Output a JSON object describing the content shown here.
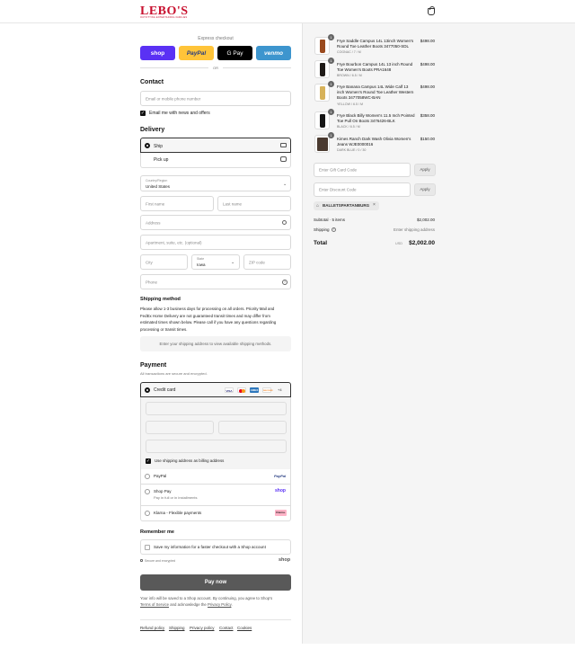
{
  "header": {
    "logo_text": "LEBO'S",
    "logo_tagline": "OUTFITTING ENTERTAINING FAMILIES",
    "cart_icon": "shopping-bag-icon"
  },
  "express": {
    "title": "Express checkout",
    "buttons": [
      {
        "label": "shop",
        "color": "#5a31f4"
      },
      {
        "label": "PayPal",
        "color": "#ffc439"
      },
      {
        "label": "G Pay",
        "color": "#000000"
      },
      {
        "label": "venmo",
        "color": "#3d95ce"
      }
    ],
    "or_label": "OR"
  },
  "contact": {
    "title": "Contact",
    "email_placeholder": "Email or mobile phone number",
    "news_label": "Email me with news and offers"
  },
  "delivery": {
    "title": "Delivery",
    "options": [
      {
        "label": "Ship",
        "icon": "truck-icon",
        "selected": true
      },
      {
        "label": "Pick up",
        "icon": "store-icon",
        "selected": false
      }
    ],
    "country_label": "Country/Region",
    "country_value": "United States",
    "first_name_ph": "First name",
    "last_name_ph": "Last name",
    "address_ph": "Address",
    "apartment_ph": "Apartment, suite, etc. (optional)",
    "city_ph": "City",
    "state_label": "State",
    "state_value": "Iowa",
    "zip_ph": "ZIP code",
    "phone_ph": "Phone"
  },
  "shipping_method": {
    "title": "Shipping method",
    "note": "Please allow 1-3 business days for processing on all orders. Priority Mail and FedEx Home Delivery are not guaranteed transit times and may differ from estimated times shown below. Please call if you have any questions regarding processing or transit times.",
    "placeholder_box": "Enter your shipping address to view available shipping methods."
  },
  "payment": {
    "title": "Payment",
    "subtitle": "All transactions are secure and encrypted.",
    "credit_card_label": "Credit card",
    "card_brands": [
      {
        "label": "VISA",
        "color": "#ffffff",
        "text": "#1a1f71"
      },
      {
        "label": "MC",
        "color": "#ffffff",
        "text": "#eb001b"
      },
      {
        "label": "AMEX",
        "color": "#2e77bc",
        "text": "#ffffff"
      },
      {
        "label": "DISCOVER",
        "color": "#ffffff",
        "text": "#f58220"
      }
    ],
    "more_cards": "+4",
    "billing_label": "Use shipping address as billing address",
    "methods": [
      {
        "label": "PayPal",
        "sub": "",
        "badge": "PayPal"
      },
      {
        "label": "Shop Pay",
        "sub": "Pay in full or in installments",
        "badge": "shop"
      },
      {
        "label": "Klarna - Flexible payments",
        "sub": "",
        "badge": "Klarna."
      }
    ]
  },
  "remember": {
    "title": "Remember me",
    "save_label": "Save my information for a faster checkout with a Shop account",
    "secure_label": "Secure and encrypted",
    "shop_logo": "shop"
  },
  "pay_now": "Pay now",
  "legal": {
    "line1": "Your info will be saved to a Shop account. By continuing, you agree to Shop's",
    "terms": "Terms of Service",
    "and_ack": "and acknowledge the",
    "privacy": "Privacy Policy",
    "period": "."
  },
  "footer_links": [
    "Refund policy",
    "Shipping",
    "Privacy policy",
    "Contact",
    "Cookies"
  ],
  "cart": {
    "items": [
      {
        "qty": "1",
        "name": "Frye Saddle Campus 14L 13inch Women's Round Toe Leather Boots 3477050-SDL",
        "variant": "COGNAC / 7 / M",
        "price": "$498.00",
        "color": "#9a4a1e"
      },
      {
        "qty": "1",
        "name": "Frye Bourbon Campus 14L 13 inch Round Toe Women's Boots PRA1648",
        "variant": "BROWN / 6.5 / M",
        "price": "$498.00",
        "color": "#1e1a17"
      },
      {
        "qty": "1",
        "name": "Frye Banana Campus 14L Wide Calf 13 inch Women's Round Toe Leather Western Boots 3477058WC-BAN",
        "variant": "YELLOW / 6.5 / M",
        "price": "$498.00",
        "color": "#d7b25a"
      },
      {
        "qty": "1",
        "name": "Frye Black Billy Women's 11.5 Inch Pointed Toe Pull On Boots 3476426-BLK",
        "variant": "BLACK / 6.5 / M",
        "price": "$358.00",
        "color": "#141414"
      },
      {
        "qty": "1",
        "name": "Kimes Ranch Dark Wash Olivia Women's Jeans WJE0000016",
        "variant": "DARK BLUE / 0 / 30",
        "price": "$150.00",
        "color": "#4a3a30"
      }
    ],
    "gift_ph": "Enter Gift Card Code",
    "discount_ph": "Enter Discount Code",
    "apply": "Apply",
    "applied_code": "BALLETSPARTANBURG",
    "subtotal_label": "Subtotal · 5 items",
    "subtotal_value": "$2,002.00",
    "shipping_label": "Shipping",
    "shipping_value": "Enter shipping address",
    "total_label": "Total",
    "total_currency": "USD",
    "total_value": "$2,002.00"
  }
}
